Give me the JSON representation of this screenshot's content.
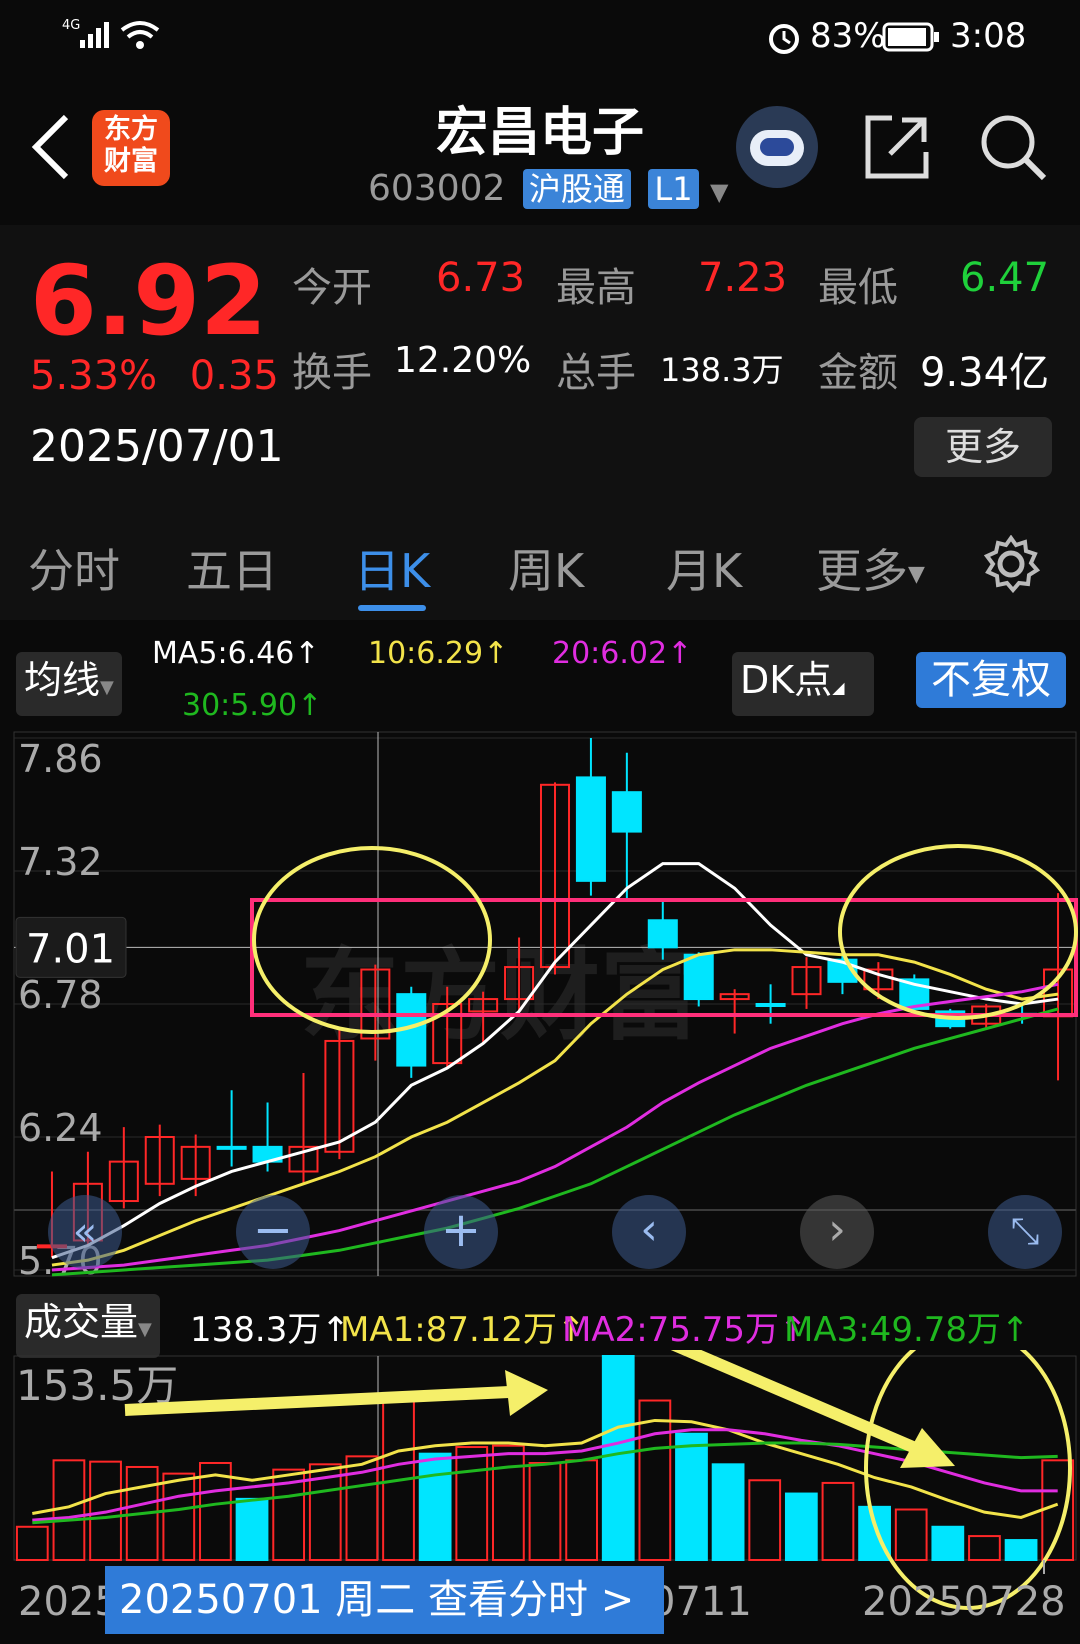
{
  "status_bar": {
    "network": "4G",
    "battery": "83%",
    "time": "3:08"
  },
  "header": {
    "title": "宏昌电子",
    "code": "603002",
    "tag1": "沪股通",
    "tag2": "L1",
    "logo_line1": "东方",
    "logo_line2": "财富"
  },
  "quote": {
    "price": "6.92",
    "change_pct": "5.33%",
    "change_abs": "0.35",
    "date": "2025/07/01",
    "open_label": "今开",
    "open": "6.73",
    "high_label": "最高",
    "high": "7.23",
    "low_label": "最低",
    "low": "6.47",
    "turnover_label": "换手",
    "turnover": "12.20%",
    "volume_label": "总手",
    "volume": "138.3万",
    "amount_label": "金额",
    "amount": "9.34亿",
    "more": "更多"
  },
  "tabs": [
    "分时",
    "五日",
    "日K",
    "周K",
    "月K",
    "更多"
  ],
  "active_tab": "日K",
  "ma_bar": {
    "select": "均线",
    "ma5": "MA5:6.46↑",
    "ma10": "10:6.29↑",
    "ma20": "20:6.02↑",
    "ma30": "30:5.90↑",
    "dk": "DK点",
    "fuquan": "不复权"
  },
  "volume_bar": {
    "select": "成交量",
    "vol": "138.3万↑",
    "ma1": "MA1:87.12万↑",
    "ma2": "MA2:75.75万↑",
    "ma3": "MA3:49.78万↑"
  },
  "date_bar": "20250701 周二 查看分时 >",
  "colors": {
    "up": "#ff2727",
    "down": "#00e5ff",
    "ma5": "#ffffff",
    "ma10": "#f2e34a",
    "ma20": "#e02de0",
    "ma30": "#1fb81f",
    "accent": "#3d8fe9"
  },
  "chart_data": [
    {
      "type": "candlestick",
      "title": "",
      "ylim": [
        5.7,
        7.86
      ],
      "y_ticks": [
        "7.86",
        "7.32",
        "6.78",
        "6.24",
        "5.70"
      ],
      "crosshair_value": "7.01",
      "x_tick_labels": [
        "2025",
        "0711",
        "20250728"
      ],
      "candles": [
        {
          "o": 5.8,
          "h": 6.1,
          "l": 5.75,
          "c": 5.8,
          "up": true
        },
        {
          "o": 5.82,
          "h": 6.18,
          "l": 5.8,
          "c": 6.05,
          "up": true
        },
        {
          "o": 5.98,
          "h": 6.28,
          "l": 5.95,
          "c": 6.14,
          "up": true
        },
        {
          "o": 6.05,
          "h": 6.29,
          "l": 6.0,
          "c": 6.24,
          "up": true
        },
        {
          "o": 6.07,
          "h": 6.25,
          "l": 6.0,
          "c": 6.2,
          "up": true
        },
        {
          "o": 6.2,
          "h": 6.43,
          "l": 6.12,
          "c": 6.2,
          "up": false
        },
        {
          "o": 6.2,
          "h": 6.38,
          "l": 6.1,
          "c": 6.14,
          "up": false
        },
        {
          "o": 6.1,
          "h": 6.5,
          "l": 6.05,
          "c": 6.2,
          "up": true
        },
        {
          "o": 6.18,
          "h": 6.68,
          "l": 6.15,
          "c": 6.63,
          "up": true
        },
        {
          "o": 6.64,
          "h": 6.94,
          "l": 6.55,
          "c": 6.92,
          "up": true
        },
        {
          "o": 6.82,
          "h": 6.85,
          "l": 6.48,
          "c": 6.53,
          "up": false
        },
        {
          "o": 6.54,
          "h": 6.85,
          "l": 6.52,
          "c": 6.78,
          "up": true
        },
        {
          "o": 6.75,
          "h": 6.83,
          "l": 6.62,
          "c": 6.8,
          "up": true
        },
        {
          "o": 6.8,
          "h": 7.05,
          "l": 6.75,
          "c": 6.93,
          "up": true
        },
        {
          "o": 6.93,
          "h": 7.68,
          "l": 6.9,
          "c": 7.67,
          "up": true
        },
        {
          "o": 7.7,
          "h": 7.86,
          "l": 7.22,
          "c": 7.28,
          "up": false
        },
        {
          "o": 7.64,
          "h": 7.8,
          "l": 7.2,
          "c": 7.48,
          "up": false
        },
        {
          "o": 7.12,
          "h": 7.2,
          "l": 6.96,
          "c": 7.01,
          "up": false
        },
        {
          "o": 6.98,
          "h": 6.99,
          "l": 6.77,
          "c": 6.8,
          "up": false
        },
        {
          "o": 6.8,
          "h": 6.84,
          "l": 6.66,
          "c": 6.82,
          "up": true
        },
        {
          "o": 6.78,
          "h": 6.86,
          "l": 6.7,
          "c": 6.78,
          "up": false
        },
        {
          "o": 6.82,
          "h": 6.97,
          "l": 6.76,
          "c": 6.93,
          "up": true
        },
        {
          "o": 6.96,
          "h": 7.0,
          "l": 6.82,
          "c": 6.87,
          "up": false
        },
        {
          "o": 6.84,
          "h": 6.95,
          "l": 6.8,
          "c": 6.92,
          "up": true
        },
        {
          "o": 6.88,
          "h": 6.9,
          "l": 6.74,
          "c": 6.76,
          "up": false
        },
        {
          "o": 6.75,
          "h": 6.76,
          "l": 6.68,
          "c": 6.69,
          "up": false
        },
        {
          "o": 6.7,
          "h": 6.78,
          "l": 6.68,
          "c": 6.77,
          "up": true
        },
        {
          "o": 6.74,
          "h": 6.78,
          "l": 6.7,
          "c": 6.74,
          "up": false
        },
        {
          "o": 6.73,
          "h": 7.23,
          "l": 6.47,
          "c": 6.92,
          "up": true
        }
      ],
      "series": [
        {
          "name": "MA5",
          "values": [
            5.75,
            5.8,
            5.88,
            5.97,
            6.04,
            6.1,
            6.14,
            6.18,
            6.22,
            6.3,
            6.45,
            6.52,
            6.62,
            6.75,
            6.95,
            7.1,
            7.25,
            7.35,
            7.35,
            7.25,
            7.1,
            6.98,
            6.95,
            6.9,
            6.86,
            6.83,
            6.8,
            6.78,
            6.8
          ]
        },
        {
          "name": "10",
          "values": [
            5.72,
            5.74,
            5.78,
            5.84,
            5.9,
            5.95,
            6.0,
            6.05,
            6.1,
            6.16,
            6.24,
            6.3,
            6.38,
            6.46,
            6.55,
            6.7,
            6.82,
            6.92,
            6.98,
            7.0,
            7.0,
            6.99,
            6.98,
            6.98,
            6.95,
            6.9,
            6.84,
            6.8,
            6.82
          ]
        },
        {
          "name": "20",
          "values": [
            5.7,
            5.71,
            5.72,
            5.74,
            5.76,
            5.78,
            5.8,
            5.83,
            5.86,
            5.9,
            5.94,
            5.98,
            6.02,
            6.06,
            6.12,
            6.2,
            6.28,
            6.38,
            6.46,
            6.53,
            6.6,
            6.65,
            6.7,
            6.74,
            6.77,
            6.79,
            6.81,
            6.83,
            6.86
          ]
        },
        {
          "name": "30",
          "values": [
            5.68,
            5.69,
            5.7,
            5.71,
            5.72,
            5.73,
            5.74,
            5.76,
            5.78,
            5.81,
            5.84,
            5.87,
            5.91,
            5.95,
            6.0,
            6.05,
            6.12,
            6.19,
            6.26,
            6.33,
            6.39,
            6.45,
            6.5,
            6.55,
            6.6,
            6.64,
            6.68,
            6.72,
            6.76
          ]
        }
      ]
    },
    {
      "type": "bar",
      "title": "",
      "y_ticks": [
        "153.5万"
      ],
      "ylim": [
        0,
        153.5
      ],
      "values": [
        25,
        75,
        74,
        70,
        65,
        73,
        46,
        68,
        72,
        78,
        125,
        80,
        85,
        86,
        73,
        75,
        153.5,
        120,
        95,
        72,
        60,
        50,
        58,
        40,
        38,
        25,
        18,
        15,
        75
      ],
      "up": [
        true,
        true,
        true,
        true,
        true,
        true,
        false,
        true,
        true,
        true,
        true,
        false,
        true,
        true,
        true,
        true,
        false,
        true,
        false,
        false,
        true,
        false,
        true,
        false,
        true,
        false,
        true,
        false,
        true
      ],
      "series": [
        {
          "name": "MA1",
          "values": [
            35,
            40,
            50,
            55,
            60,
            64,
            60,
            64,
            68,
            72,
            82,
            86,
            88,
            88,
            86,
            88,
            100,
            105,
            104,
            98,
            88,
            80,
            72,
            62,
            55,
            45,
            36,
            32,
            42
          ]
        },
        {
          "name": "MA2",
          "values": [
            30,
            32,
            36,
            42,
            48,
            52,
            55,
            58,
            62,
            66,
            72,
            76,
            78,
            80,
            80,
            82,
            88,
            95,
            98,
            98,
            95,
            90,
            86,
            80,
            74,
            66,
            58,
            52,
            52
          ]
        },
        {
          "name": "MA3",
          "values": [
            28,
            30,
            32,
            35,
            38,
            42,
            45,
            48,
            52,
            56,
            60,
            64,
            67,
            70,
            72,
            75,
            80,
            84,
            86,
            87,
            88,
            88,
            87,
            85,
            83,
            81,
            79,
            77,
            78
          ]
        }
      ]
    }
  ]
}
